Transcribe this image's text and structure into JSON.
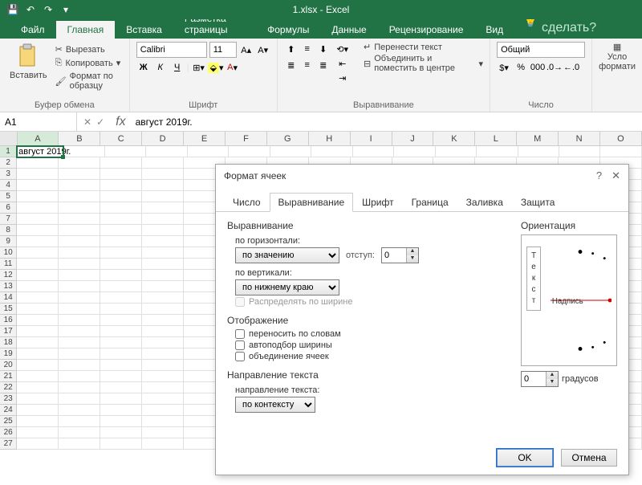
{
  "app": {
    "title": "1.xlsx - Excel"
  },
  "tabs": {
    "file": "Файл",
    "home": "Главная",
    "insert": "Вставка",
    "layout": "Разметка страницы",
    "formulas": "Формулы",
    "data": "Данные",
    "review": "Рецензирование",
    "view": "Вид",
    "tell_me": "Что вы хотите сделать?"
  },
  "ribbon": {
    "clipboard": {
      "paste": "Вставить",
      "cut": "Вырезать",
      "copy": "Копировать",
      "format_painter": "Формат по образцу",
      "label": "Буфер обмена"
    },
    "font": {
      "name": "Calibri",
      "size": "11",
      "bold": "Ж",
      "italic": "К",
      "underline": "Ч",
      "label": "Шрифт"
    },
    "alignment": {
      "wrap": "Перенести текст",
      "merge": "Объединить и поместить в центре",
      "label": "Выравнивание"
    },
    "number": {
      "format": "Общий",
      "label": "Число"
    },
    "styles": {
      "cond": "Усло",
      "format": "формати"
    }
  },
  "formula_bar": {
    "name_box": "A1",
    "fx": "fx",
    "value": "август 2019г."
  },
  "grid": {
    "cols": [
      "A",
      "B",
      "C",
      "D",
      "E",
      "F",
      "G",
      "H",
      "I",
      "J",
      "K",
      "L",
      "M",
      "N",
      "O"
    ],
    "rows": 27,
    "a1": "август 2019г."
  },
  "dialog": {
    "title": "Формат ячеек",
    "tabs": {
      "number": "Число",
      "alignment": "Выравнивание",
      "font": "Шрифт",
      "border": "Граница",
      "fill": "Заливка",
      "protection": "Защита"
    },
    "alignment_section": "Выравнивание",
    "horizontal_label": "по горизонтали:",
    "horizontal_value": "по значению",
    "indent_label": "отступ:",
    "indent_value": "0",
    "vertical_label": "по вертикали:",
    "vertical_value": "по нижнему краю",
    "distribute": "Распределять по ширине",
    "display_section": "Отображение",
    "wrap_text": "переносить по словам",
    "shrink": "автоподбор ширины",
    "merge_cells": "объединение ячеек",
    "direction_section": "Направление текста",
    "direction_label": "направление текста:",
    "direction_value": "по контексту",
    "orientation_label": "Ориентация",
    "orient_vert_text": "Текст",
    "orient_horiz_text": "Надпись",
    "degrees_value": "0",
    "degrees_label": "градусов",
    "ok": "OK",
    "cancel": "Отмена"
  }
}
